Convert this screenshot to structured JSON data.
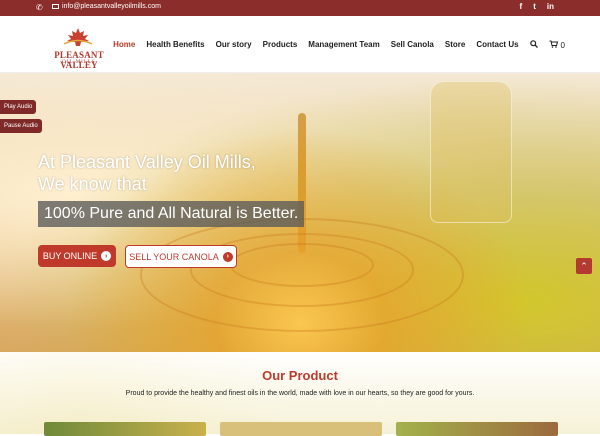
{
  "topbar": {
    "phone_icon": "phone-icon",
    "email": "info@pleasantvalleyoilmills.com",
    "social": [
      "f",
      "t",
      "in"
    ]
  },
  "logo": {
    "name": "PLEASANT VALLEY",
    "sub": "OIL MILLS"
  },
  "nav": {
    "items": [
      "Home",
      "Health Benefits",
      "Our story",
      "Products",
      "Management Team",
      "Sell Canola",
      "Store",
      "Contact Us"
    ],
    "active": "Home",
    "cart_count": "0"
  },
  "hero": {
    "headline": "At Pleasant Valley Oil Mills, We know that",
    "tagline": "100% Pure and All Natural is Better.",
    "buy_label": "BUY ONLINE",
    "sell_label": "SELL YOUR CANOLA"
  },
  "audio": {
    "play": "Play Audio",
    "pause": "Pause Audio"
  },
  "product": {
    "title": "Our Product",
    "description": "Proud to provide the healthy and finest oils in the world, made with love in our hearts, so they are good for yours."
  },
  "colors": {
    "brand": "#8b2d2a",
    "accent": "#c03a2b"
  }
}
